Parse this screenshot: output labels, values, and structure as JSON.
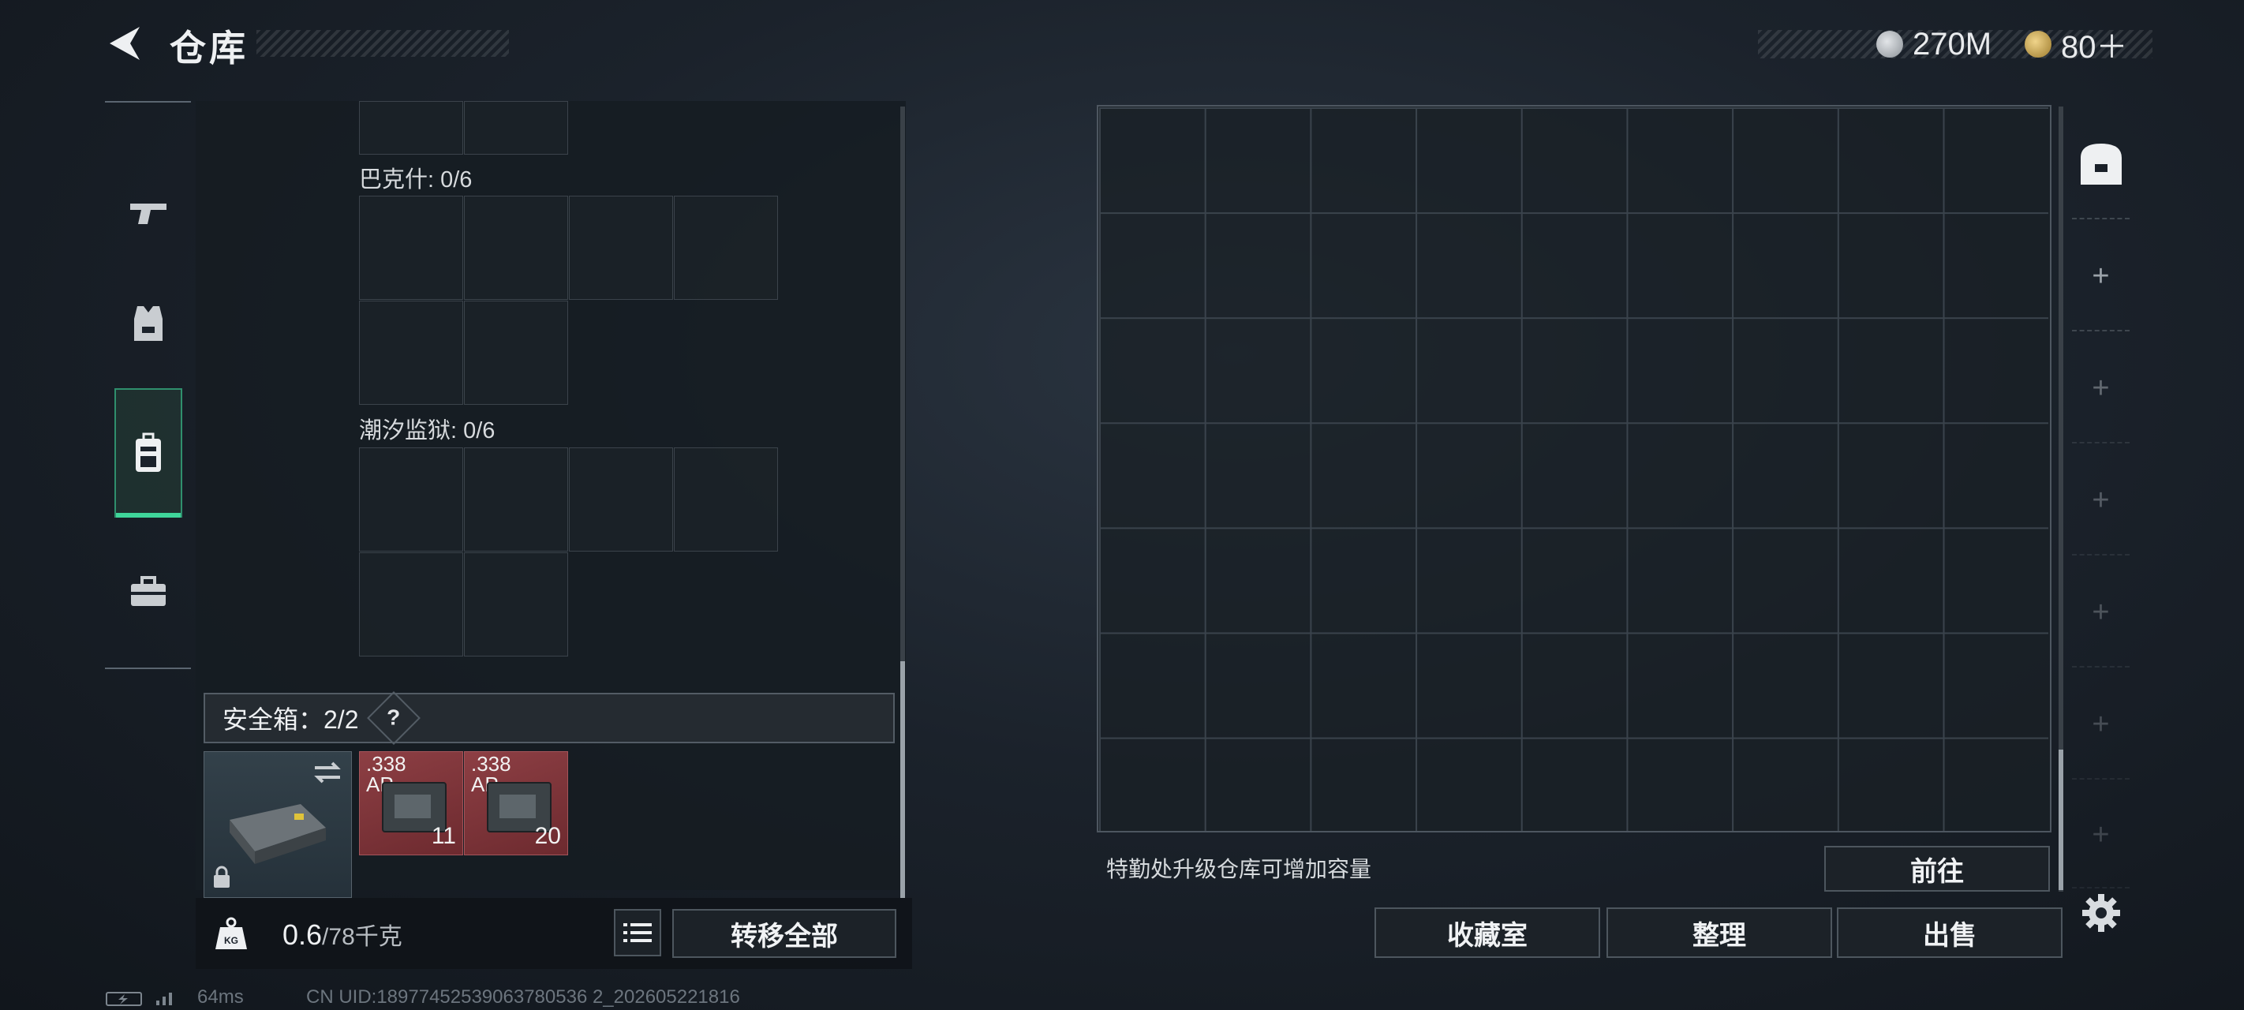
{
  "header": {
    "title": "仓库",
    "currency1": {
      "value": "270M",
      "icon": "silver-coin-icon",
      "color": "#b9bec3"
    },
    "currency2": {
      "value": "80＋",
      "icon": "gold-coin-icon",
      "color": "#c9a44d"
    }
  },
  "sidebar": {
    "items": [
      {
        "icon": "pistol-icon",
        "active": false
      },
      {
        "icon": "vest-icon",
        "active": false
      },
      {
        "icon": "backpack-icon",
        "active": true
      },
      {
        "icon": "toolbox-icon",
        "active": false
      }
    ]
  },
  "left": {
    "section1": "巴克什: 0/6",
    "section2": "潮汐监狱: 0/6",
    "safe_label": "安全箱：2/2",
    "help": "?",
    "ammo": [
      {
        "caliber": ".338",
        "type": "AP",
        "count": "11"
      },
      {
        "caliber": ".338",
        "type": "AP",
        "count": "20"
      }
    ],
    "weight": "0.6",
    "weight_total": "/78千克",
    "weight_icon_text": "KG",
    "transfer_all": "转移全部"
  },
  "right": {
    "info": "特勤处升级仓库可增加容量",
    "goto": "前往",
    "collection": "收藏室",
    "organize": "整理",
    "sell": "出售",
    "plus": "+"
  },
  "footer": {
    "ping": "64ms",
    "uid": "CN UID:18977452539063780536 2_202605221816"
  },
  "accent": "#3fd69a"
}
